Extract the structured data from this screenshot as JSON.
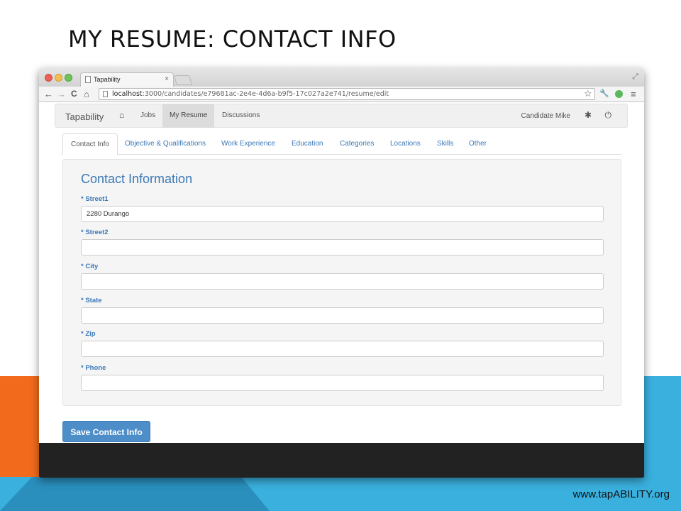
{
  "slide": {
    "title": "MY RESUME: CONTACT INFO",
    "footer_url": "www.tapABILITY.org"
  },
  "browser": {
    "tab_title": "Tapability",
    "tab_close": "×",
    "url_host": "localhost",
    "url_rest": ":3000/candidates/e79681ac-2e4e-4d6a-b9f5-17c027a2e741/resume/edit",
    "back": "←",
    "forward": "→",
    "reload": "C",
    "home": "⌂",
    "star": "☆",
    "wrench": "🔧",
    "menu": "≡",
    "resize": "⤢"
  },
  "navbar": {
    "brand": "Tapability",
    "home_icon": "⌂",
    "items": [
      {
        "label": "Jobs"
      },
      {
        "label": "My Resume"
      },
      {
        "label": "Discussions"
      }
    ],
    "user": "Candidate Mike",
    "gear_icon": "✱",
    "power_icon": "⏻"
  },
  "resume_tabs": [
    {
      "label": "Contact Info"
    },
    {
      "label": "Objective & Qualifications"
    },
    {
      "label": "Work Experience"
    },
    {
      "label": "Education"
    },
    {
      "label": "Categories"
    },
    {
      "label": "Locations"
    },
    {
      "label": "Skills"
    },
    {
      "label": "Other"
    }
  ],
  "form": {
    "title": "Contact Information",
    "fields": [
      {
        "label": "* Street1",
        "value": "2280 Durango"
      },
      {
        "label": "* Street2",
        "value": ""
      },
      {
        "label": "* City",
        "value": ""
      },
      {
        "label": "* State",
        "value": ""
      },
      {
        "label": "* Zip",
        "value": ""
      },
      {
        "label": "* Phone",
        "value": ""
      }
    ],
    "save_label": "Save Contact Info"
  },
  "colors": {
    "accent": "#3a78b6",
    "button": "#4d8ec9",
    "orange": "#f26b1d",
    "blue": "#3ab0de"
  }
}
